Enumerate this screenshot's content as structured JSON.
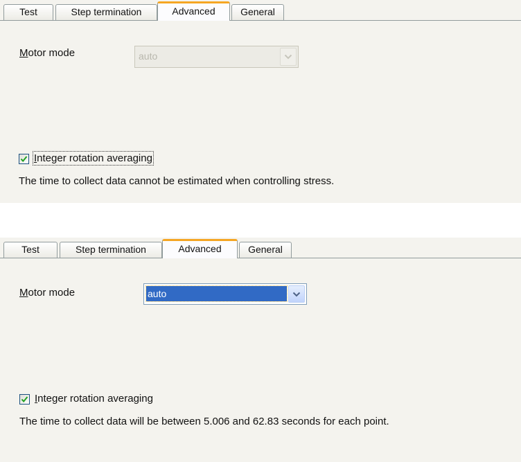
{
  "colors": {
    "panel_background": "#f4f3ee",
    "active_tab_accent": "#f5a623",
    "selection_highlight": "#316ac5",
    "check_mark": "#21a121"
  },
  "panels": [
    {
      "tabs": [
        {
          "label": "Test",
          "active": false
        },
        {
          "label": "Step termination",
          "active": false
        },
        {
          "label": "Advanced",
          "active": true
        },
        {
          "label": "General",
          "active": false
        }
      ],
      "motor_mode": {
        "label_first_letter": "M",
        "label_rest": "otor mode",
        "value": "auto",
        "state": "disabled",
        "dropdown_icon": "chevron-down-icon"
      },
      "integer_rotation": {
        "checked": true,
        "label_first_letter": "I",
        "label_rest": "nteger rotation averaging",
        "focused": true
      },
      "message": "The time to collect data cannot be estimated when controlling stress."
    },
    {
      "tabs": [
        {
          "label": "Test",
          "active": false
        },
        {
          "label": "Step termination",
          "active": false
        },
        {
          "label": "Advanced",
          "active": true
        },
        {
          "label": "General",
          "active": false
        }
      ],
      "motor_mode": {
        "label_first_letter": "M",
        "label_rest": "otor mode",
        "value": "auto",
        "state": "focused",
        "dropdown_icon": "chevron-down-icon"
      },
      "integer_rotation": {
        "checked": true,
        "label_first_letter": "I",
        "label_rest": "nteger rotation averaging",
        "focused": false
      },
      "message": "The time to collect data will be between 5.006 and 62.83 seconds for each point."
    }
  ]
}
